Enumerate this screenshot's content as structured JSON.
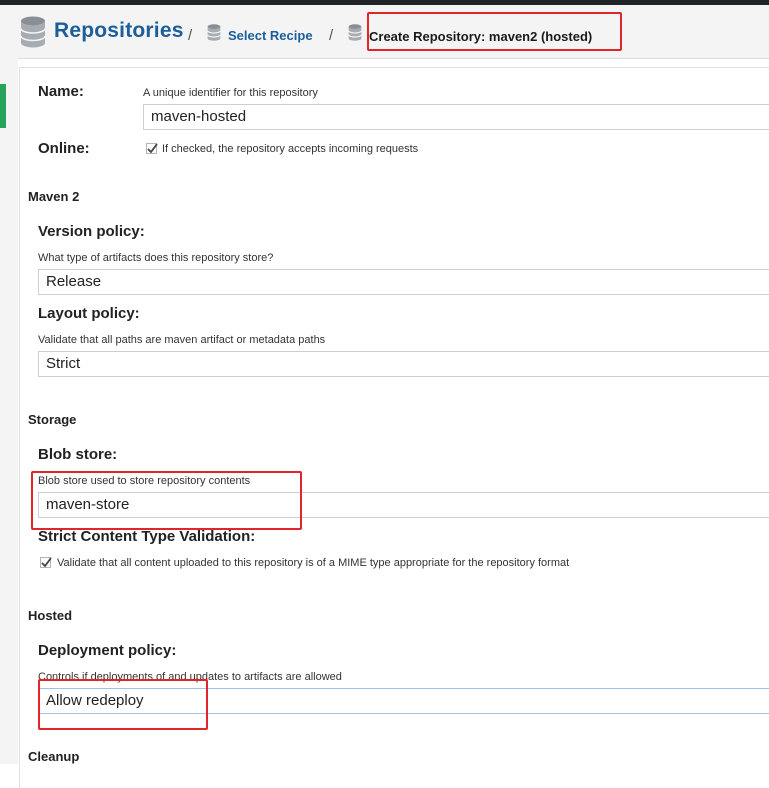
{
  "header": {
    "title": "Repositories",
    "separator": "/",
    "crumb_link": "Select Recipe",
    "crumb_current": "Create Repository: maven2 (hosted)"
  },
  "form": {
    "name": {
      "label": "Name:",
      "hint": "A unique identifier for this repository",
      "value": "maven-hosted"
    },
    "online": {
      "label": "Online:",
      "checkbox_text": "If checked, the repository accepts incoming requests",
      "checked": true
    },
    "maven": {
      "section": "Maven 2",
      "version_policy": {
        "label": "Version policy:",
        "hint": "What type of artifacts does this repository store?",
        "value": "Release"
      },
      "layout_policy": {
        "label": "Layout policy:",
        "hint": "Validate that all paths are maven artifact or metadata paths",
        "value": "Strict"
      }
    },
    "storage": {
      "section": "Storage",
      "blob_store": {
        "label": "Blob store:",
        "hint": "Blob store used to store repository contents",
        "value": "maven-store"
      },
      "strict_validation": {
        "label": "Strict Content Type Validation:",
        "checkbox_text": "Validate that all content uploaded to this repository is of a MIME type appropriate for the repository format",
        "checked": true
      }
    },
    "hosted": {
      "section": "Hosted",
      "deployment_policy": {
        "label": "Deployment policy:",
        "hint": "Controls if deployments of and updates to artifacts are allowed",
        "value": "Allow redeploy"
      }
    },
    "cleanup": {
      "section": "Cleanup"
    }
  },
  "icons": {
    "database": "database-icon",
    "check": "check-icon"
  },
  "colors": {
    "brand": "#1b5e9a",
    "highlight": "#e0262a",
    "accent": "#27a35a"
  }
}
